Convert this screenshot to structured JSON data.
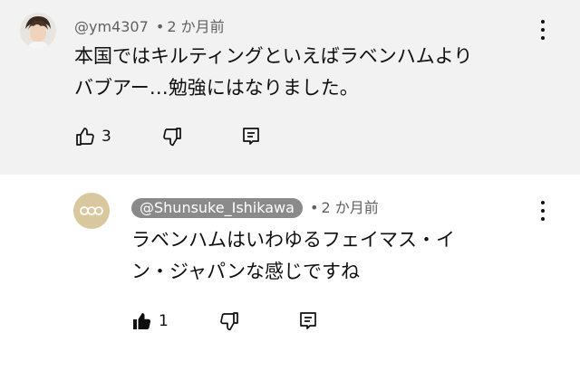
{
  "comments": [
    {
      "author": "@ym4307",
      "time": "2 か月前",
      "lines": [
        "本国ではキルティングといえばラベンハムより",
        "バブアー…勉強にはなりました。"
      ],
      "likes": "3",
      "liked": false,
      "icons": {
        "avatar": "user-avatar-photo",
        "like": "thumb-up-outline-icon",
        "dislike": "thumb-down-outline-icon",
        "reply": "reply-comment-icon",
        "more": "more-vert-icon"
      }
    },
    {
      "author": "@Shunsuke_Ishikawa",
      "time": "2 か月前",
      "lines": [
        "ラベンハムはいわゆるフェイマス・イ",
        "ン・ジャパンな感じですね"
      ],
      "likes": "1",
      "liked": true,
      "icons": {
        "avatar": "channel-avatar-ooo",
        "like": "thumb-up-filled-icon",
        "dislike": "thumb-down-outline-icon",
        "reply": "reply-comment-icon",
        "more": "more-vert-icon"
      }
    }
  ],
  "meta_separator": "•",
  "avatar_text": "ooo",
  "colors": {
    "parent_bg": "#f2f2f2",
    "reply_bg": "#ffffff",
    "meta_text": "#606060",
    "creator_chip_bg": "#8a8a8a",
    "creator_avatar_bg": "#d9c89e"
  }
}
